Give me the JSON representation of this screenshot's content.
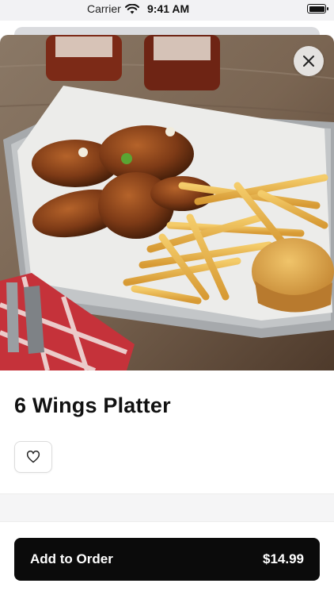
{
  "status_bar": {
    "carrier": "Carrier",
    "time": "9:41 AM",
    "icons": [
      "wifi-icon",
      "battery-icon"
    ]
  },
  "item": {
    "name": "6 Wings Platter",
    "image": "wings-fries-cornbread-photo"
  },
  "actions": {
    "close_icon": "close-icon",
    "favorite_icon": "heart-icon"
  },
  "order": {
    "label": "Add to Order",
    "price": "$14.99"
  },
  "colors": {
    "button_bg": "#0b0b0b",
    "button_text": "#ffffff",
    "sheet_bg": "#ffffff"
  }
}
